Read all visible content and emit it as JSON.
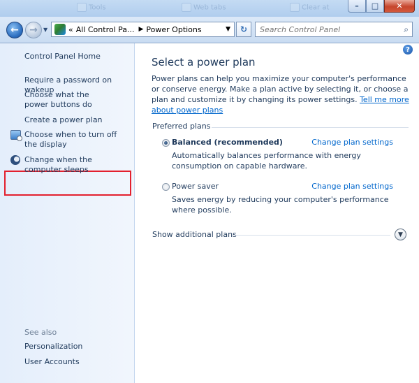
{
  "title_bar": {
    "background_tabs": [
      "Tools",
      "Web tabs",
      "Clear at"
    ],
    "minimize": "–",
    "maximize": "□",
    "close": "✕"
  },
  "address_bar": {
    "overflow_marker": "«",
    "crumbs": [
      "All Control Pa...",
      "Power Options"
    ],
    "search_placeholder": "Search Control Panel"
  },
  "left_nav": {
    "home": "Control Panel Home",
    "items": [
      "Require a password on wakeup",
      "Choose what the power buttons do",
      "Create a power plan",
      "Choose when to turn off the display",
      "Change when the computer sleeps"
    ],
    "see_also_heading": "See also",
    "see_also": [
      "Personalization",
      "User Accounts"
    ]
  },
  "content": {
    "heading": "Select a power plan",
    "intro": "Power plans can help you maximize your computer's performance or conserve energy. Make a plan active by selecting it, or choose a plan and customize it by changing its power settings.",
    "intro_link": "Tell me more about power plans",
    "group_heading": "Preferred plans",
    "plans": [
      {
        "name": "Balanced (recommended)",
        "selected": true,
        "description": "Automatically balances performance with energy consumption on capable hardware.",
        "link": "Change plan settings"
      },
      {
        "name": "Power saver",
        "selected": false,
        "description": "Saves energy by reducing your computer's performance where possible.",
        "link": "Change plan settings"
      }
    ],
    "additional_plans": "Show additional plans"
  },
  "colors": {
    "link": "#0066cc",
    "text": "#1e395b",
    "highlight_box": "#e3202e"
  }
}
